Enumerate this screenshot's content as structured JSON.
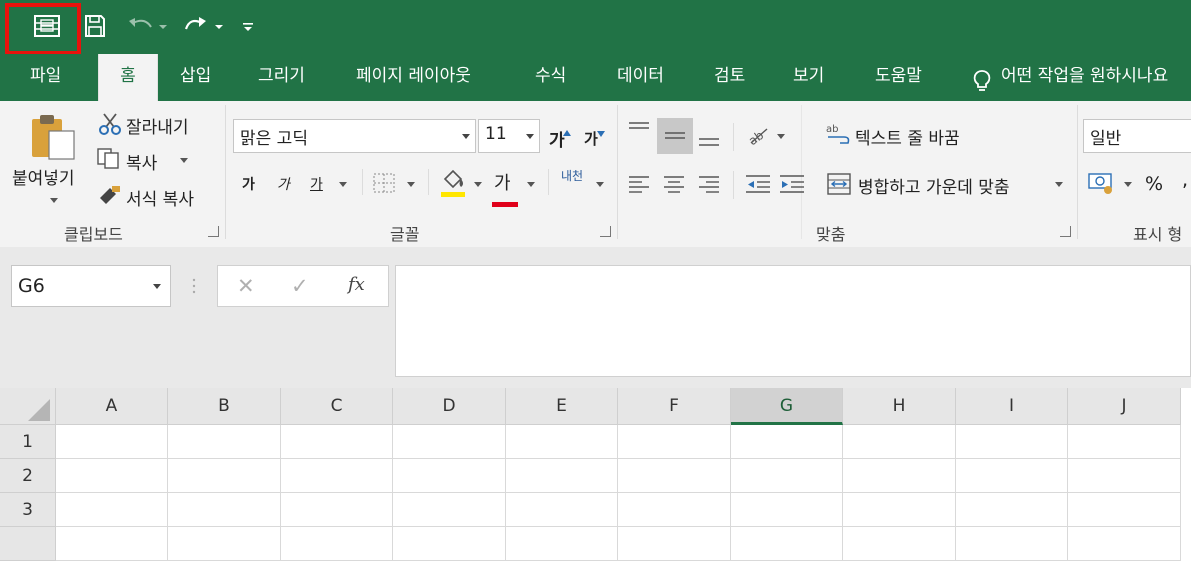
{
  "colors": {
    "brand": "#217346",
    "highlight": "#e8120c",
    "fill_yellow": "#ffe600",
    "font_red": "#e0001a"
  },
  "qat": {
    "icons": [
      "form-icon",
      "save-icon",
      "undo-icon",
      "redo-icon",
      "customize-qat-icon"
    ]
  },
  "tabs": [
    {
      "label": "파일"
    },
    {
      "label": "홈"
    },
    {
      "label": "삽입"
    },
    {
      "label": "그리기"
    },
    {
      "label": "페이지 레이아웃"
    },
    {
      "label": "수식"
    },
    {
      "label": "데이터"
    },
    {
      "label": "검토"
    },
    {
      "label": "보기"
    },
    {
      "label": "도움말"
    },
    {
      "label": "어떤 작업을 원하시나요"
    }
  ],
  "clipboard": {
    "paste_label": "붙여넣기",
    "cut_label": "잘라내기",
    "copy_label": "복사",
    "format_painter_label": "서식 복사",
    "group_label": "클립보드"
  },
  "font": {
    "font_name": "맑은 고딕",
    "font_size": "11",
    "grow_label": "가",
    "shrink_label": "가",
    "bold_label": "가",
    "italic_label": "가",
    "underline_label": "가",
    "font_color_label": "가",
    "phonetic_label": "내천",
    "group_label": "글꼴"
  },
  "alignment": {
    "wrap_text_label": "텍스트 줄 바꿈",
    "merge_label": "병합하고 가운데 맞춤",
    "group_label": "맞춤"
  },
  "number": {
    "format_value": "일반",
    "percent_label": "%",
    "group_label": "표시 형"
  },
  "formula_bar": {
    "name_box": "G6",
    "cancel_label": "✕",
    "enter_label": "✓",
    "fx_label": "fx",
    "content": ""
  },
  "sheet": {
    "columns": [
      "A",
      "B",
      "C",
      "D",
      "E",
      "F",
      "G",
      "H",
      "I",
      "J"
    ],
    "selected_column": "G",
    "rows": [
      "1",
      "2",
      "3"
    ]
  }
}
